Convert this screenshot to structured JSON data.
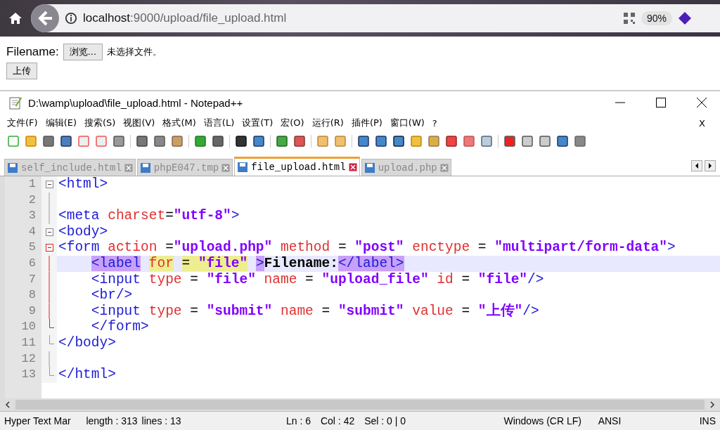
{
  "browser": {
    "url_host": "localhost",
    "url_path": ":9000/upload/file_upload.html",
    "zoom": "90%"
  },
  "page": {
    "label": "Filename:",
    "browse_button": "浏览...",
    "file_status": "未选择文件。",
    "submit_button": "上传"
  },
  "editor_window": {
    "title": "D:\\wamp\\upload\\file_upload.html - Notepad++",
    "menu": [
      "文件(F)",
      "编辑(E)",
      "搜索(S)",
      "视图(V)",
      "格式(M)",
      "语言(L)",
      "设置(T)",
      "宏(O)",
      "运行(R)",
      "插件(P)",
      "窗口(W)",
      "?"
    ],
    "menu_close": "X",
    "tabs": [
      {
        "label": "self_include.html",
        "selected": false
      },
      {
        "label": "phpE047.tmp",
        "selected": false
      },
      {
        "label": "file_upload.html",
        "selected": true
      },
      {
        "label": "upload.php",
        "selected": false
      }
    ],
    "lines": [
      {
        "number": "1",
        "current": false,
        "fold": {
          "kind": "toggle",
          "in_block": false
        },
        "tokens": [
          {
            "text": "<html>",
            "kind": "tag"
          }
        ]
      },
      {
        "number": "2",
        "current": false,
        "fold": {
          "kind": "line",
          "in_block": false
        }
      },
      {
        "number": "3",
        "current": false,
        "fold": {
          "kind": "line",
          "in_block": false
        },
        "tokens": [
          {
            "text": "<meta",
            "kind": "tag"
          },
          {
            "text": " charset",
            "kind": "attr"
          },
          {
            "text": "=",
            "kind": "op"
          },
          {
            "text": "\"utf-8\"",
            "kind": "str"
          },
          {
            "text": ">",
            "kind": "tag"
          }
        ]
      },
      {
        "number": "4",
        "current": false,
        "fold": {
          "kind": "toggle",
          "in_block": false
        },
        "tokens": [
          {
            "text": "<body>",
            "kind": "tag"
          }
        ]
      },
      {
        "number": "5",
        "current": false,
        "fold": {
          "kind": "toggle",
          "in_block": true
        },
        "tokens": [
          {
            "text": "<form",
            "kind": "tag"
          },
          {
            "text": " action ",
            "kind": "attr"
          },
          {
            "text": "=",
            "kind": "op"
          },
          {
            "text": "\"upload.php\"",
            "kind": "str"
          },
          {
            "text": " method ",
            "kind": "attr"
          },
          {
            "text": "= ",
            "kind": "op"
          },
          {
            "text": "\"post\"",
            "kind": "str"
          },
          {
            "text": " enctype ",
            "kind": "attr"
          },
          {
            "text": "= ",
            "kind": "op"
          },
          {
            "text": "\"multipart/form-data\"",
            "kind": "str"
          },
          {
            "text": ">",
            "kind": "tag"
          }
        ]
      },
      {
        "number": "6",
        "current": true,
        "fold": {
          "kind": "line",
          "in_block": true
        },
        "tokens": [
          {
            "text": "    <label",
            "kind": "tag",
            "tag_match": true
          },
          {
            "text": " for",
            "kind": "attr",
            "word_match": true
          },
          {
            "text": " = ",
            "kind": "op",
            "word_match": true
          },
          {
            "text": "\"file\"",
            "kind": "str",
            "word_match": true
          },
          {
            "text": " >",
            "kind": "tag",
            "tag_match": true
          },
          {
            "text": "Filename:",
            "kind": "text"
          },
          {
            "text": "</label>",
            "kind": "tag",
            "tag_match": true
          }
        ]
      },
      {
        "number": "7",
        "current": false,
        "fold": {
          "kind": "line",
          "in_block": true
        },
        "tokens": [
          {
            "text": "    <input",
            "kind": "tag"
          },
          {
            "text": " type ",
            "kind": "attr"
          },
          {
            "text": "= ",
            "kind": "op"
          },
          {
            "text": "\"file\"",
            "kind": "str"
          },
          {
            "text": " name ",
            "kind": "attr"
          },
          {
            "text": "= ",
            "kind": "op"
          },
          {
            "text": "\"upload_file\"",
            "kind": "str"
          },
          {
            "text": " id ",
            "kind": "attr"
          },
          {
            "text": "= ",
            "kind": "op"
          },
          {
            "text": "\"file\"",
            "kind": "str"
          },
          {
            "text": "/>",
            "kind": "tag"
          }
        ]
      },
      {
        "number": "8",
        "current": false,
        "fold": {
          "kind": "line",
          "in_block": true
        },
        "tokens": [
          {
            "text": "    <br/>",
            "kind": "tag"
          }
        ]
      },
      {
        "number": "9",
        "current": false,
        "fold": {
          "kind": "line",
          "in_block": true
        },
        "tokens": [
          {
            "text": "    <input",
            "kind": "tag"
          },
          {
            "text": " type ",
            "kind": "attr"
          },
          {
            "text": "= ",
            "kind": "op"
          },
          {
            "text": "\"submit\"",
            "kind": "str"
          },
          {
            "text": " name ",
            "kind": "attr"
          },
          {
            "text": "= ",
            "kind": "op"
          },
          {
            "text": "\"submit\"",
            "kind": "str"
          },
          {
            "text": " value ",
            "kind": "attr"
          },
          {
            "text": "= ",
            "kind": "op"
          },
          {
            "text": "\"上传\"",
            "kind": "str"
          },
          {
            "text": "/>",
            "kind": "tag"
          }
        ]
      },
      {
        "number": "10",
        "current": false,
        "fold": {
          "kind": "end",
          "in_block": true
        },
        "tokens": [
          {
            "text": "    </form>",
            "kind": "tag"
          }
        ]
      },
      {
        "number": "11",
        "current": false,
        "fold": {
          "kind": "end",
          "in_block": false
        },
        "tokens": [
          {
            "text": "</body>",
            "kind": "tag"
          }
        ]
      },
      {
        "number": "12",
        "current": false,
        "fold": {
          "kind": "line",
          "in_block": false
        }
      },
      {
        "number": "13",
        "current": false,
        "fold": {
          "kind": "end",
          "in_block": false
        },
        "tokens": [
          {
            "text": "</html>",
            "kind": "tag"
          }
        ]
      }
    ],
    "status_bar": [
      "Hyper Text Mar",
      "length : 313",
      "lines : 13",
      "Ln : 6",
      "Col : 42",
      "Sel : 0 | 0",
      "Windows (CR LF)",
      "ANSI",
      "INS"
    ]
  }
}
